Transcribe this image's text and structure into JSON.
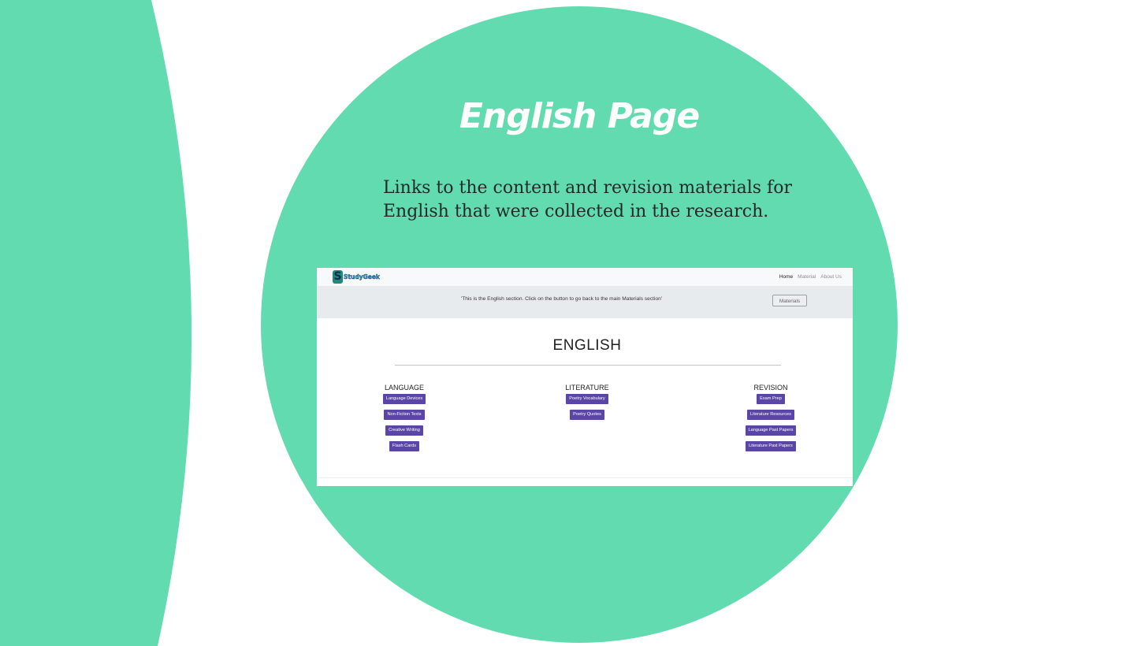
{
  "slide": {
    "title": "English Page",
    "description": "Links to the content and revision materials for English that were collected in the research.",
    "colors": {
      "accent": "#63dbb1",
      "background": "#ffffff",
      "button": "#5b46a8"
    }
  },
  "website": {
    "logo_text": "StudyGeek",
    "logo_icon": "s-logo-icon",
    "nav": {
      "items": [
        "Home",
        "Material",
        "About Us"
      ],
      "active": "Home"
    },
    "banner": {
      "text": "'This is the English section. Click on the button to go back to the main Materials section'",
      "button_label": "Materials"
    },
    "heading": "ENGLISH",
    "columns": [
      {
        "heading": "LANGUAGE",
        "buttons": [
          "Language Devices",
          "Non-Fiction Texts",
          "Creative Writing",
          "Flash Cards"
        ]
      },
      {
        "heading": "LITERATURE",
        "buttons": [
          "Poetry Vocabulary",
          "Poetry Quotes"
        ]
      },
      {
        "heading": "REVISION",
        "buttons": [
          "Exam Prep",
          "Literature Resources",
          "Language Past Papers",
          "Literature Past Papers"
        ]
      }
    ]
  }
}
